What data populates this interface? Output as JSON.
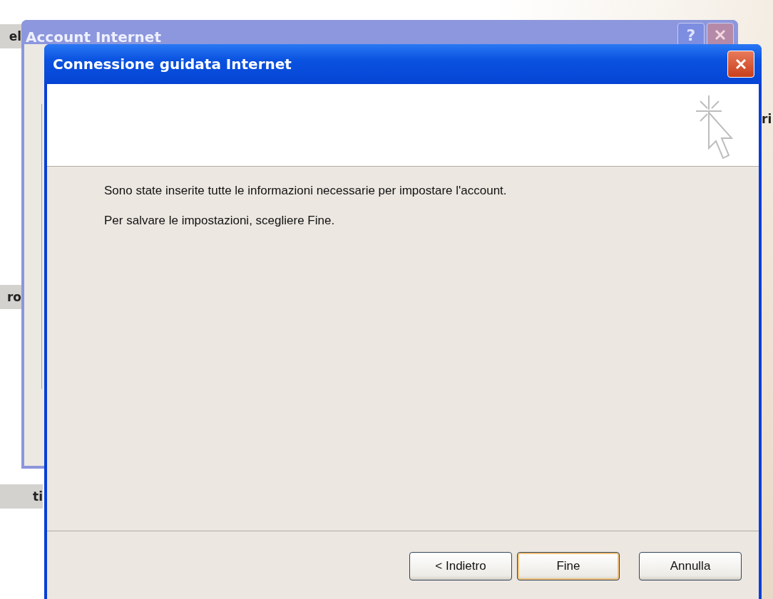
{
  "background_fragments": [
    {
      "text": "el",
      "kind": "left"
    },
    {
      "text": "ri",
      "kind": "right"
    },
    {
      "text": "ro",
      "kind": "left"
    },
    {
      "text": "ti",
      "kind": "left"
    }
  ],
  "background_window": {
    "title": "Account Internet",
    "help_button": "?",
    "active": false
  },
  "window": {
    "title": "Connessione guidata Internet",
    "active": true
  },
  "messages": [
    "Sono state inserite tutte le informazioni necessarie per impostare l'account.",
    "Per salvare le impostazioni, scegliere Fine."
  ],
  "buttons": [
    {
      "label": "< Indietro",
      "default": false
    },
    {
      "label": "Fine",
      "default": true
    },
    {
      "label": "Annulla",
      "default": false
    }
  ]
}
